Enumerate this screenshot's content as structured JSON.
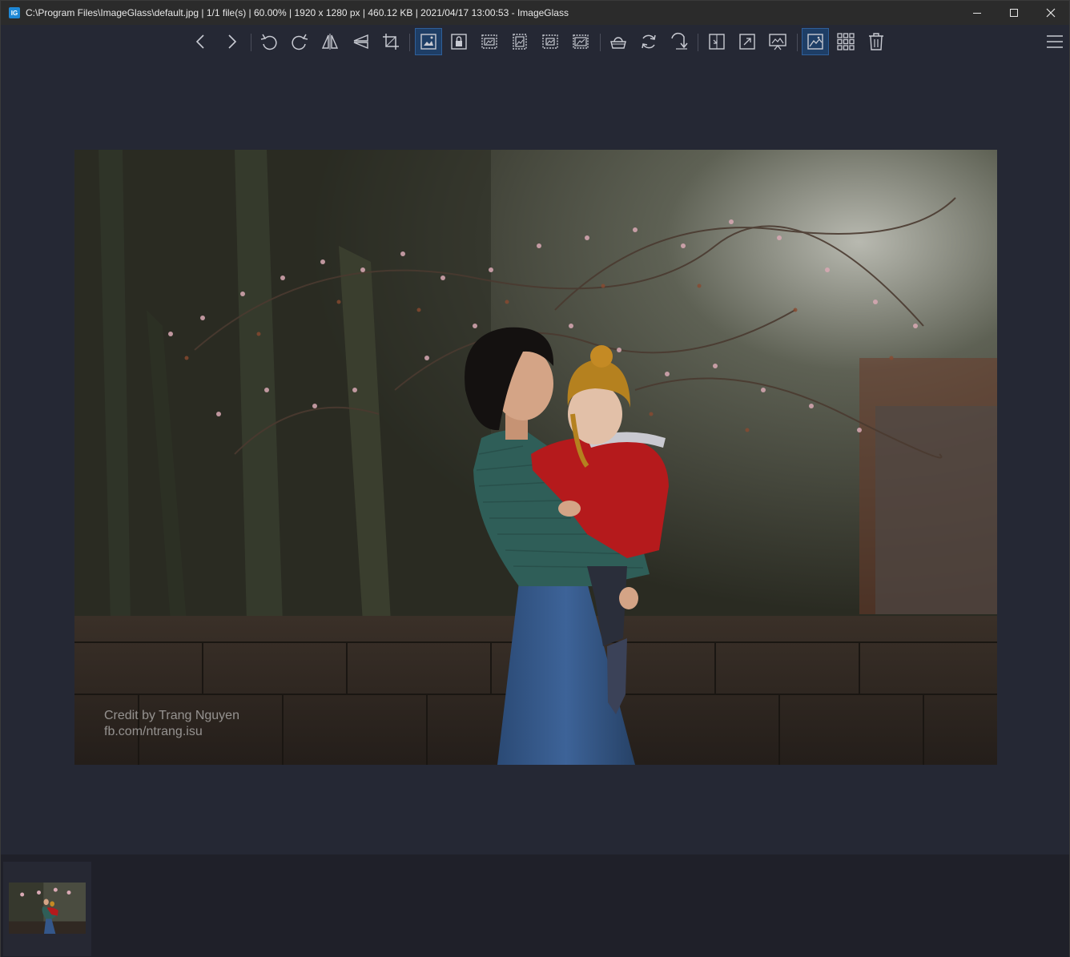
{
  "window": {
    "title": "C:\\Program Files\\ImageGlass\\default.jpg  |  1/1 file(s)  |  60.00%  |  1920 x 1280 px  |  460.12 KB  |  2021/04/17 13:00:53  - ImageGlass",
    "app_icon_label": "IG"
  },
  "toolbar": {
    "buttons": [
      {
        "name": "previous-image",
        "icon": "chevron-left-icon"
      },
      {
        "name": "next-image",
        "icon": "chevron-right-icon"
      },
      {
        "name": "rotate-left",
        "icon": "rotate-left-icon"
      },
      {
        "name": "rotate-right",
        "icon": "rotate-right-icon"
      },
      {
        "name": "flip-horizontal",
        "icon": "flip-horizontal-icon"
      },
      {
        "name": "flip-vertical",
        "icon": "flip-vertical-icon"
      },
      {
        "name": "crop",
        "icon": "crop-icon"
      },
      {
        "name": "auto-zoom",
        "icon": "auto-zoom-icon",
        "active": true
      },
      {
        "name": "lock-zoom",
        "icon": "lock-zoom-icon"
      },
      {
        "name": "scale-to-width",
        "icon": "scale-width-icon"
      },
      {
        "name": "scale-to-height",
        "icon": "scale-height-icon"
      },
      {
        "name": "scale-to-fit",
        "icon": "scale-fit-icon"
      },
      {
        "name": "scale-to-fill",
        "icon": "scale-fill-icon"
      },
      {
        "name": "open-with",
        "icon": "basket-icon"
      },
      {
        "name": "refresh",
        "icon": "refresh-icon"
      },
      {
        "name": "go-to",
        "icon": "goto-icon"
      },
      {
        "name": "window-fit",
        "icon": "window-fit-icon"
      },
      {
        "name": "fullscreen",
        "icon": "fullscreen-icon"
      },
      {
        "name": "slideshow",
        "icon": "slideshow-icon"
      },
      {
        "name": "toggle-viewer",
        "icon": "image-view-icon",
        "active": true
      },
      {
        "name": "thumbnails",
        "icon": "grid-icon"
      },
      {
        "name": "delete",
        "icon": "trash-icon"
      },
      {
        "name": "main-menu",
        "icon": "hamburger-menu-icon"
      }
    ]
  },
  "photo": {
    "credit_line1": "Credit by Trang Nguyen",
    "credit_line2": "fb.com/ntrang.isu"
  },
  "colors": {
    "background": "#252834",
    "titlebar": "#2b2b2b",
    "active_button": "#1e3e66",
    "icon": "#c8cad2"
  }
}
